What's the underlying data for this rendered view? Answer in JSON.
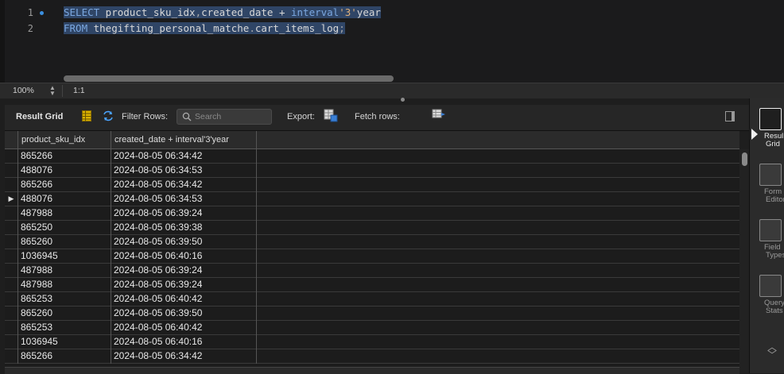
{
  "editor": {
    "lines": [
      {
        "num": "1",
        "parts": [
          {
            "t": "SELECT",
            "c": "kw"
          },
          {
            "t": " product_sku_idx",
            "c": ""
          },
          {
            "t": ",",
            "c": "punc"
          },
          {
            "t": "created_date",
            "c": ""
          },
          {
            "t": " + ",
            "c": ""
          },
          {
            "t": "interval",
            "c": "kw"
          },
          {
            "t": "'3'",
            "c": "str"
          },
          {
            "t": "year",
            "c": ""
          }
        ]
      },
      {
        "num": "2",
        "parts": [
          {
            "t": "FROM",
            "c": "kw"
          },
          {
            "t": " thegifting_personal_matche",
            "c": ""
          },
          {
            "t": ".",
            "c": "punc"
          },
          {
            "t": "cart_items_log",
            "c": ""
          },
          {
            "t": ";",
            "c": "punc"
          }
        ]
      }
    ]
  },
  "statusbar": {
    "zoom": "100%",
    "position": "1:1"
  },
  "toolbar": {
    "result_grid": "Result Grid",
    "filter_rows": "Filter Rows:",
    "search_placeholder": "Search",
    "export": "Export:",
    "fetch_rows": "Fetch rows:"
  },
  "grid": {
    "columns": [
      "product_sku_idx",
      "created_date + interval'3'year"
    ],
    "current_row_index": 3,
    "rows": [
      [
        "865266",
        "2024-08-05 06:34:42"
      ],
      [
        "488076",
        "2024-08-05 06:34:53"
      ],
      [
        "865266",
        "2024-08-05 06:34:42"
      ],
      [
        "488076",
        "2024-08-05 06:34:53"
      ],
      [
        "487988",
        "2024-08-05 06:39:24"
      ],
      [
        "865250",
        "2024-08-05 06:39:38"
      ],
      [
        "865260",
        "2024-08-05 06:39:50"
      ],
      [
        "1036945",
        "2024-08-05 06:40:16"
      ],
      [
        "487988",
        "2024-08-05 06:39:24"
      ],
      [
        "487988",
        "2024-08-05 06:39:24"
      ],
      [
        "865253",
        "2024-08-05 06:40:42"
      ],
      [
        "865260",
        "2024-08-05 06:39:50"
      ],
      [
        "865253",
        "2024-08-05 06:40:42"
      ],
      [
        "1036945",
        "2024-08-05 06:40:16"
      ],
      [
        "865266",
        "2024-08-05 06:34:42"
      ]
    ]
  },
  "side_panel": {
    "items": [
      {
        "label1": "Resul",
        "label2": "Grid",
        "icon": "result-grid-icon",
        "active": true
      },
      {
        "label1": "Form",
        "label2": "Editor",
        "icon": "form-editor-icon",
        "active": false
      },
      {
        "label1": "Field",
        "label2": "Types",
        "icon": "field-types-icon",
        "active": false
      },
      {
        "label1": "Query",
        "label2": "Stats",
        "icon": "query-stats-icon",
        "active": false
      }
    ]
  }
}
